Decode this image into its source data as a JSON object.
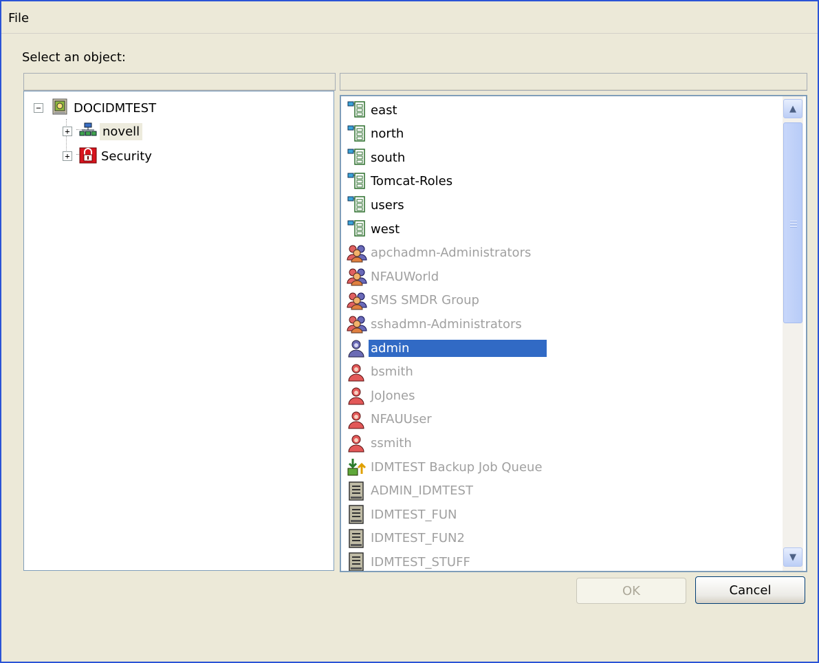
{
  "menu": {
    "file_label": "File"
  },
  "prompt": "Select an object:",
  "tree": {
    "root": {
      "label": "DOCIDMTEST",
      "expander": "−",
      "icon": "tree-root-icon"
    },
    "children": [
      {
        "label": "novell",
        "expander": "+",
        "icon": "organization-icon",
        "highlighted": true
      },
      {
        "label": "Security",
        "expander": "+",
        "icon": "security-icon",
        "highlighted": false
      }
    ]
  },
  "list": {
    "items": [
      {
        "label": "east",
        "icon": "org-unit-icon",
        "enabled": true
      },
      {
        "label": "north",
        "icon": "org-unit-icon",
        "enabled": true
      },
      {
        "label": "south",
        "icon": "org-unit-icon",
        "enabled": true
      },
      {
        "label": "Tomcat-Roles",
        "icon": "org-unit-icon",
        "enabled": true
      },
      {
        "label": "users",
        "icon": "org-unit-icon",
        "enabled": true
      },
      {
        "label": "west",
        "icon": "org-unit-icon",
        "enabled": true
      },
      {
        "label": "apchadmn-Administrators",
        "icon": "group-icon",
        "enabled": false
      },
      {
        "label": "NFAUWorld",
        "icon": "group-icon",
        "enabled": false
      },
      {
        "label": "SMS SMDR Group",
        "icon": "group-icon",
        "enabled": false
      },
      {
        "label": "sshadmn-Administrators",
        "icon": "group-icon",
        "enabled": false
      },
      {
        "label": "admin",
        "icon": "admin-user-icon",
        "enabled": true,
        "selected": true
      },
      {
        "label": "bsmith",
        "icon": "user-icon",
        "enabled": false
      },
      {
        "label": "JoJones",
        "icon": "user-icon",
        "enabled": false
      },
      {
        "label": "NFAUUser",
        "icon": "user-icon",
        "enabled": false
      },
      {
        "label": "ssmith",
        "icon": "user-icon",
        "enabled": false
      },
      {
        "label": "IDMTEST Backup Job Queue",
        "icon": "job-queue-icon",
        "enabled": false
      },
      {
        "label": "ADMIN_IDMTEST",
        "icon": "volume-icon",
        "enabled": false
      },
      {
        "label": "IDMTEST_FUN",
        "icon": "volume-icon",
        "enabled": false
      },
      {
        "label": "IDMTEST_FUN2",
        "icon": "volume-icon",
        "enabled": false
      },
      {
        "label": "IDMTEST_STUFF",
        "icon": "volume-icon",
        "enabled": false
      }
    ]
  },
  "buttons": {
    "ok_label": "OK",
    "ok_enabled": false,
    "cancel_label": "Cancel"
  },
  "colors": {
    "selection": "#316AC5",
    "window_border": "#2B54D6",
    "disabled_text": "#A0A0A0"
  }
}
